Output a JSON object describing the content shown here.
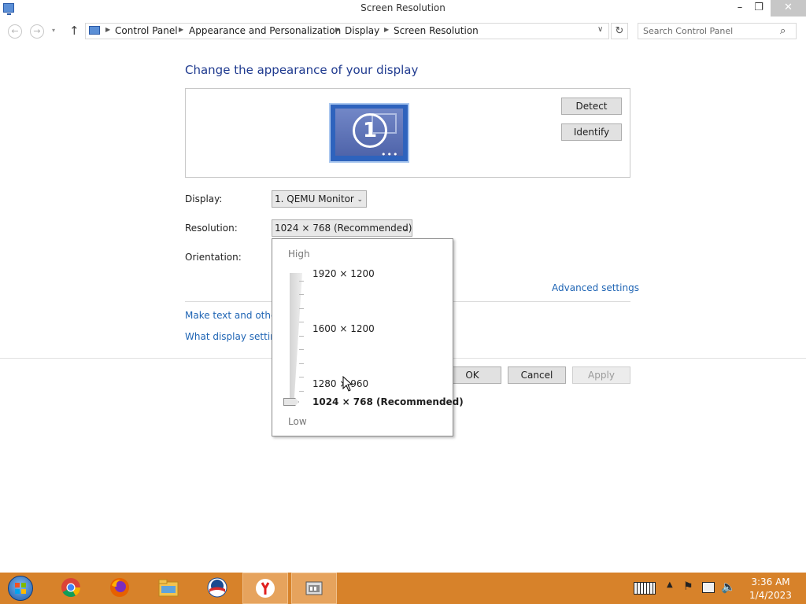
{
  "window": {
    "title": "Screen Resolution",
    "minimize": "–",
    "maximize": "❐",
    "close": "✕"
  },
  "nav": {
    "back": "←",
    "forward": "→",
    "recent": "▾",
    "up": "↑",
    "refresh": "↻",
    "dropdown": "∨"
  },
  "address": {
    "crumbs": [
      "Control Panel",
      "Appearance and Personalization",
      "Display",
      "Screen Resolution"
    ],
    "separator": "▶"
  },
  "search": {
    "placeholder": "Search Control Panel",
    "icon": "⌕"
  },
  "content": {
    "title": "Change the appearance of your display",
    "monitor_number": "1",
    "monitor_dots": "•••",
    "detect": "Detect",
    "identify": "Identify",
    "display_label": "Display:",
    "display_value": "1. QEMU Monitor",
    "resolution_label": "Resolution:",
    "resolution_value": "1024 × 768 (Recommended)",
    "orientation_label": "Orientation:",
    "advanced": "Advanced settings",
    "text_size_link": "Make text and other",
    "display_settings_link": "What display settin",
    "ok": "OK",
    "cancel": "Cancel",
    "apply": "Apply",
    "select_arrow": "⌄"
  },
  "resolution_popup": {
    "high": "High",
    "low": "Low",
    "options": [
      "1920 × 1200",
      "1600 × 1200",
      "1280 × 960",
      "1024 × 768 (Recommended)"
    ],
    "selected_index": 3
  },
  "tray": {
    "chevron": "▲",
    "flag": "⚑",
    "volume": "🔈",
    "time": "3:36 AM",
    "date": "1/4/2023"
  },
  "colors": {
    "taskbar": "#d7822a",
    "link": "#1e64b4",
    "title": "#1f3a8f"
  }
}
